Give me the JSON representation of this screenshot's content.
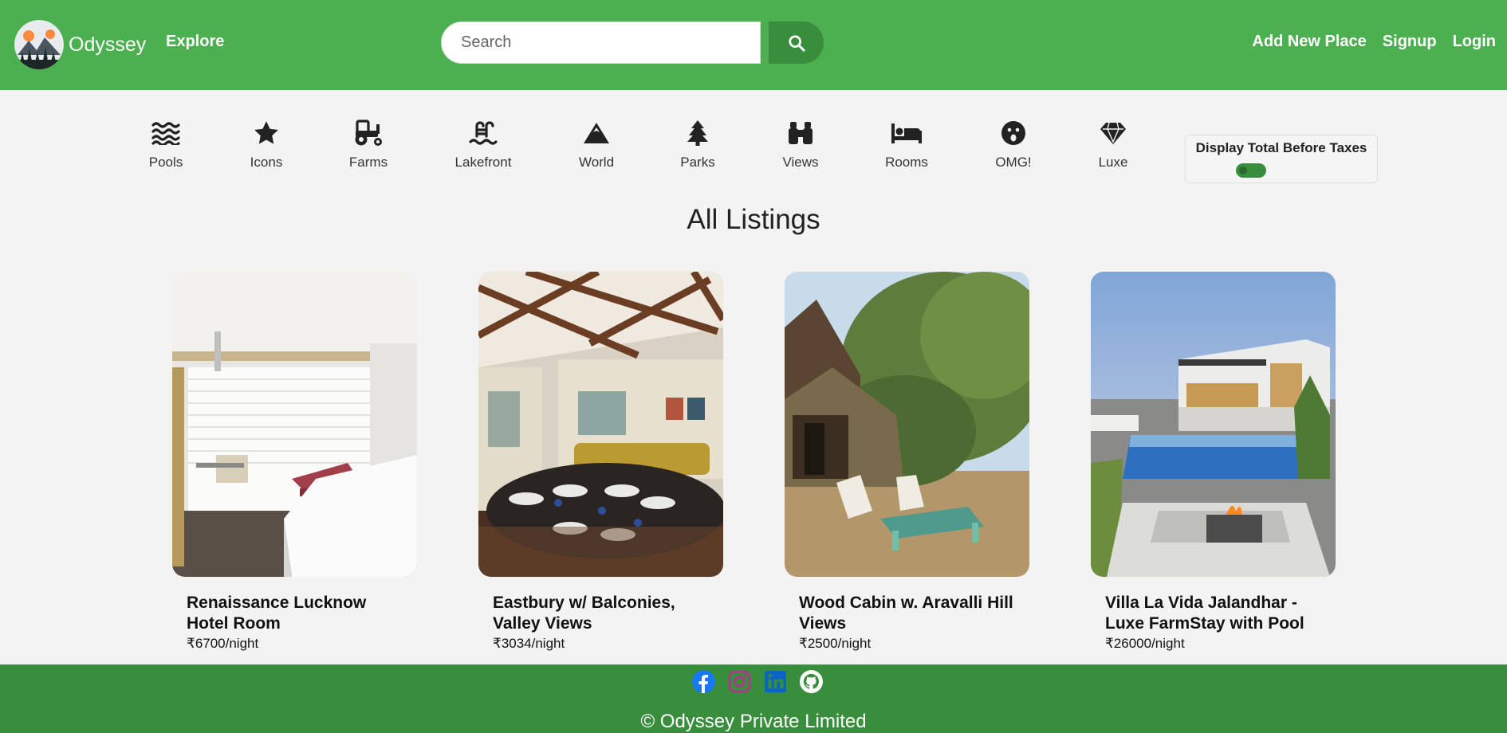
{
  "navbar": {
    "brand_name": "Odyssey",
    "explore_label": "Explore",
    "search_placeholder": "Search",
    "search_icon": "search-icon",
    "links": [
      "Add New Place",
      "Signup",
      "Login"
    ],
    "bg_color": "#4caf50",
    "button_color": "#388e3c"
  },
  "filters": [
    {
      "label": "Pools",
      "icon": "water-waves-icon"
    },
    {
      "label": "Icons",
      "icon": "star-icon"
    },
    {
      "label": "Farms",
      "icon": "tractor-icon"
    },
    {
      "label": "Lakefront",
      "icon": "swimming-pool-ladder-icon"
    },
    {
      "label": "World",
      "icon": "mountain-icon"
    },
    {
      "label": "Parks",
      "icon": "tree-icon"
    },
    {
      "label": "Views",
      "icon": "binoculars-icon"
    },
    {
      "label": "Rooms",
      "icon": "bed-icon"
    },
    {
      "label": "OMG!",
      "icon": "surprised-face-icon"
    },
    {
      "label": "Luxe",
      "icon": "gem-icon"
    }
  ],
  "tax_toggle": {
    "label": "Display Total Before Taxes",
    "checked": false
  },
  "page_title": "All Listings",
  "listings": [
    {
      "title": "Renaissance Lucknow Hotel Room",
      "price": "₹6700/night",
      "image": "hotel room with bed and window blinds"
    },
    {
      "title": "Eastbury w/ Balconies, Valley Views",
      "price": "₹3034/night",
      "image": "dining room with wooden ceiling beams"
    },
    {
      "title": "Wood Cabin w. Aravalli Hill Views",
      "price": "₹2500/night",
      "image": "wooden cabin with lawn chairs"
    },
    {
      "title": "Villa La Vida Jalandhar - Luxe FarmStay with Pool",
      "price": "₹26000/night",
      "image": "modern villa with pool and fire pit"
    }
  ],
  "footer": {
    "socials": [
      "facebook-icon",
      "instagram-icon",
      "linkedin-icon",
      "github-icon"
    ],
    "copyright": "© Odyssey Private Limited",
    "bg_color": "#388e3c"
  }
}
